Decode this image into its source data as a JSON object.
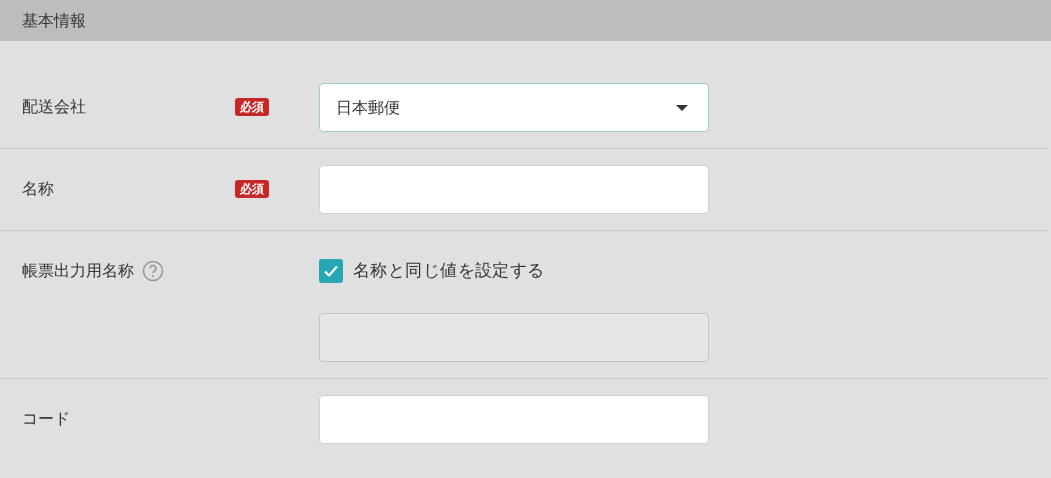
{
  "section": {
    "title": "基本情報"
  },
  "fields": [
    {
      "kind": "select",
      "label": "配送会社",
      "required": true,
      "badge": "必須",
      "value": "日本郵便"
    },
    {
      "kind": "text",
      "label": "名称",
      "required": true,
      "badge": "必須"
    },
    {
      "kind": "checkbox_text",
      "label": "帳票出力用名称",
      "required": false,
      "help": true,
      "checkbox": {
        "label": "名称と同じ値を設定する",
        "checked": true
      },
      "disabled": true
    },
    {
      "kind": "text",
      "label": "コード",
      "required": false
    }
  ]
}
